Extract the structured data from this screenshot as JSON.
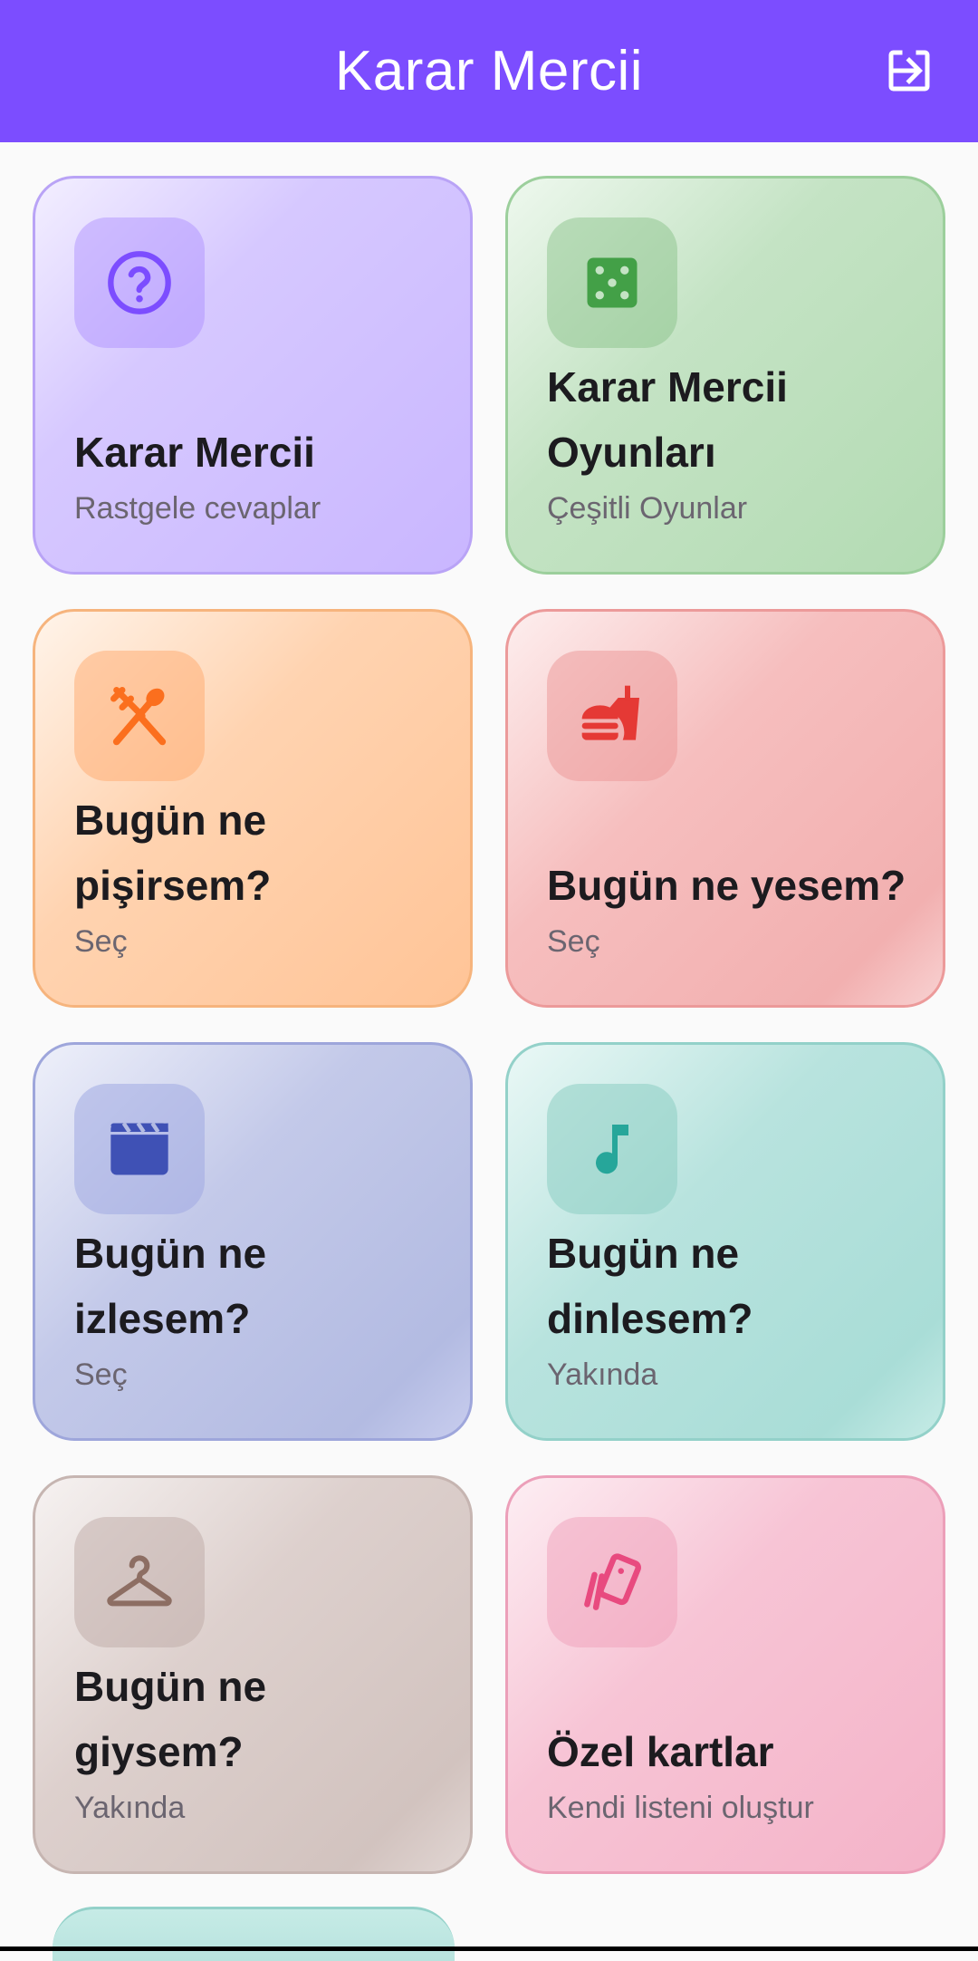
{
  "app_bar": {
    "title": "Karar Mercii",
    "action_icon": "logout-icon"
  },
  "cards": [
    {
      "title": "Karar Mercii",
      "subtitle": "Rastgele cevaplar",
      "icon": "help-circle-icon",
      "accent": "#7c4dff"
    },
    {
      "title": "Karar Mercii Oyunları",
      "subtitle": "Çeşitli Oyunlar",
      "icon": "dice-icon",
      "accent": "#43a047"
    },
    {
      "title": "Bugün ne pişirsem?",
      "subtitle": "Seç",
      "icon": "utensils-icon",
      "accent": "#fb6f1e"
    },
    {
      "title": "Bugün ne yesem?",
      "subtitle": "Seç",
      "icon": "fastfood-icon",
      "accent": "#e53935"
    },
    {
      "title": "Bugün ne izlesem?",
      "subtitle": "Seç",
      "icon": "movie-icon",
      "accent": "#3f51b5"
    },
    {
      "title": "Bugün ne dinlesem?",
      "subtitle": "Yakında",
      "icon": "music-note-icon",
      "accent": "#26a69a"
    },
    {
      "title": "Bugün ne giysem?",
      "subtitle": "Yakında",
      "icon": "hanger-icon",
      "accent": "#8d6e63"
    },
    {
      "title": "Özel kartlar",
      "subtitle": "Kendi listeni oluştur",
      "icon": "cards-icon",
      "accent": "#e84a7f"
    }
  ],
  "colors": {
    "app_bar": "#7c4dff",
    "background": "#fafafa"
  }
}
